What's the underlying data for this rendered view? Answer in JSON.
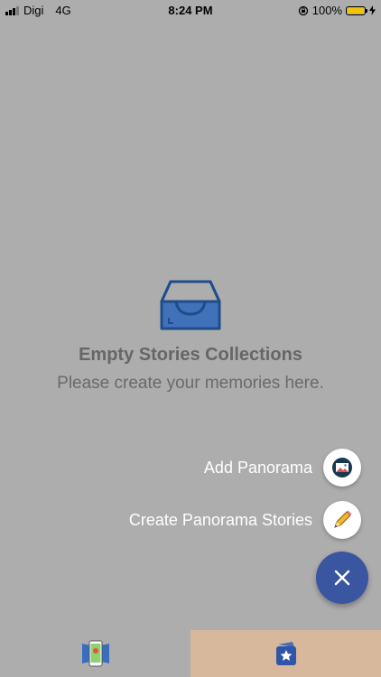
{
  "status_bar": {
    "carrier": "Digi",
    "network": "4G",
    "time": "8:24 PM",
    "battery_percent": "100%",
    "battery_level": 1.0,
    "icons": [
      "signal-icon",
      "orientation-lock-icon",
      "battery-icon",
      "charging-bolt-icon"
    ]
  },
  "empty_state": {
    "icon": "empty-inbox-icon",
    "title": "Empty Stories Collections",
    "subtitle": "Please create your memories here."
  },
  "fab_menu": {
    "items": [
      {
        "label": "Add Panorama",
        "icon": "image-icon"
      },
      {
        "label": "Create Panorama Stories",
        "icon": "pencil-icon"
      }
    ],
    "main_icon": "close-icon",
    "main_color": "#3a56a0"
  },
  "tab_bar": {
    "tabs": [
      {
        "icon": "panorama-phone-icon",
        "active": false
      },
      {
        "icon": "star-stories-icon",
        "active": true
      }
    ],
    "active_color": "#d7b89c"
  },
  "colors": {
    "background": "#adadad",
    "accent": "#3a56a0"
  }
}
